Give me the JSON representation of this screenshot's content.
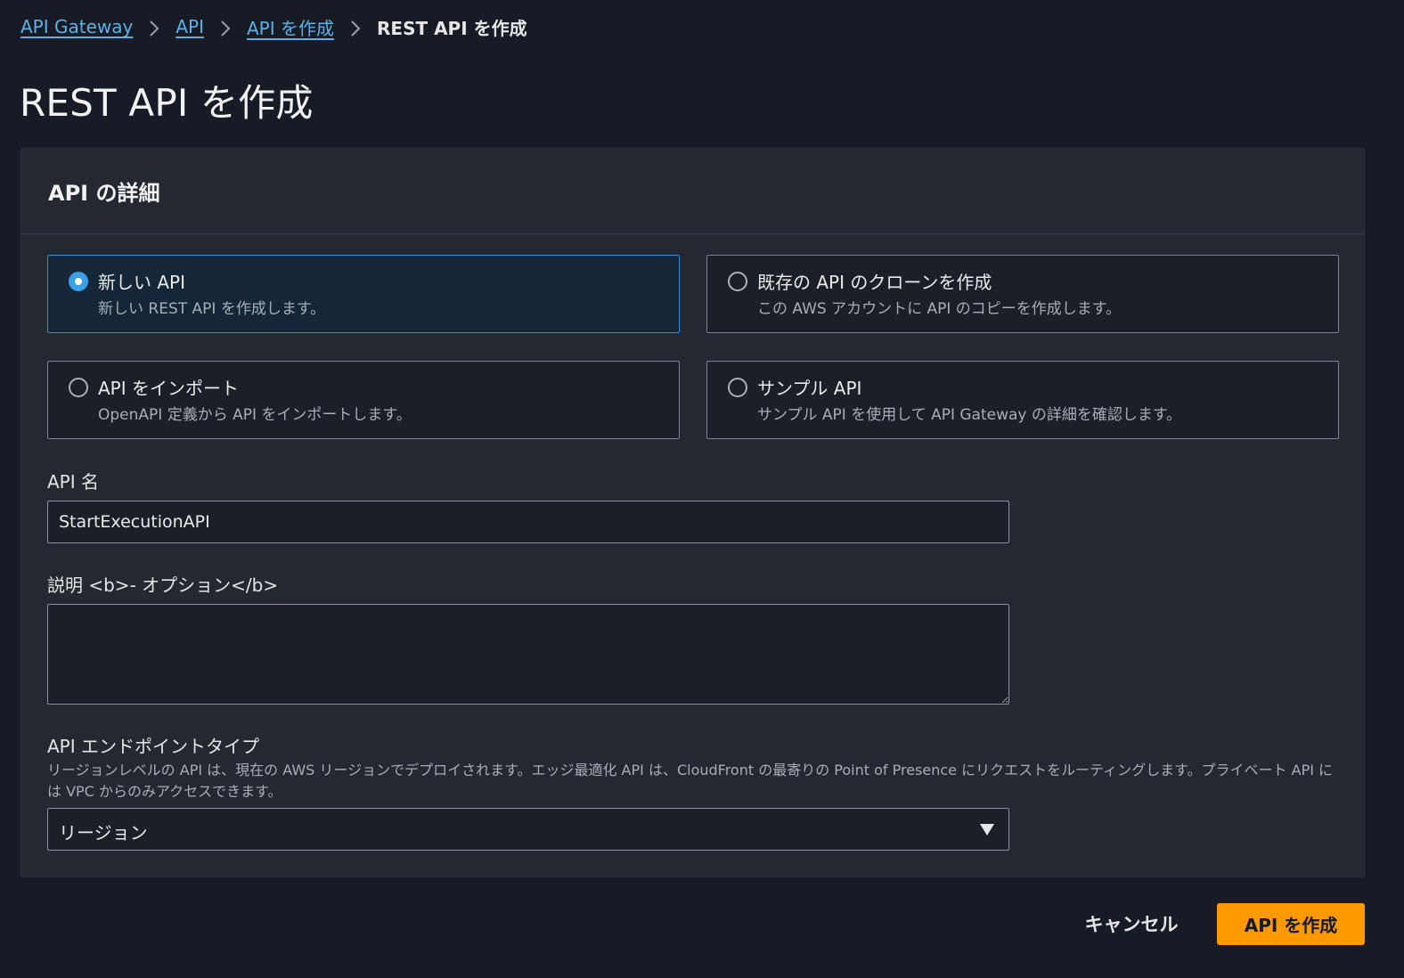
{
  "breadcrumb": {
    "items": [
      {
        "label": "API Gateway"
      },
      {
        "label": "API"
      },
      {
        "label": "API を作成"
      }
    ],
    "current": "REST API を作成"
  },
  "page": {
    "title": "REST API を作成"
  },
  "details_panel": {
    "heading": "API の詳細",
    "options": [
      {
        "title": "新しい API",
        "description": "新しい REST API を作成します。",
        "selected": true
      },
      {
        "title": "既存の API のクローンを作成",
        "description": "この AWS アカウントに API のコピーを作成します。",
        "selected": false
      },
      {
        "title": "API をインポート",
        "description": "OpenAPI 定義から API をインポートします。",
        "selected": false
      },
      {
        "title": "サンプル API",
        "description": "サンプル API を使用して API Gateway の詳細を確認します。",
        "selected": false
      }
    ],
    "api_name": {
      "label": "API 名",
      "value": "StartExecutionAPI"
    },
    "description": {
      "label": "説明 <b>- オプション</b>",
      "value": ""
    },
    "endpoint_type": {
      "label": "API エンドポイントタイプ",
      "description": "リージョンレベルの API は、現在の AWS リージョンでデプロイされます。エッジ最適化 API は、CloudFront の最寄りの Point of Presence にリクエストをルーティングします。プライベート API には VPC からのみアクセスできます。",
      "selected": "リージョン"
    }
  },
  "actions": {
    "cancel_label": "キャンセル",
    "create_label": "API を作成"
  },
  "colors": {
    "accent": "#ff9900",
    "link": "#5cb2e8",
    "selected_border": "#2d8fd0"
  },
  "icons": {
    "separator": "chevron-right-icon",
    "select": "caret-down-icon",
    "resize": "resize-handle-icon"
  }
}
